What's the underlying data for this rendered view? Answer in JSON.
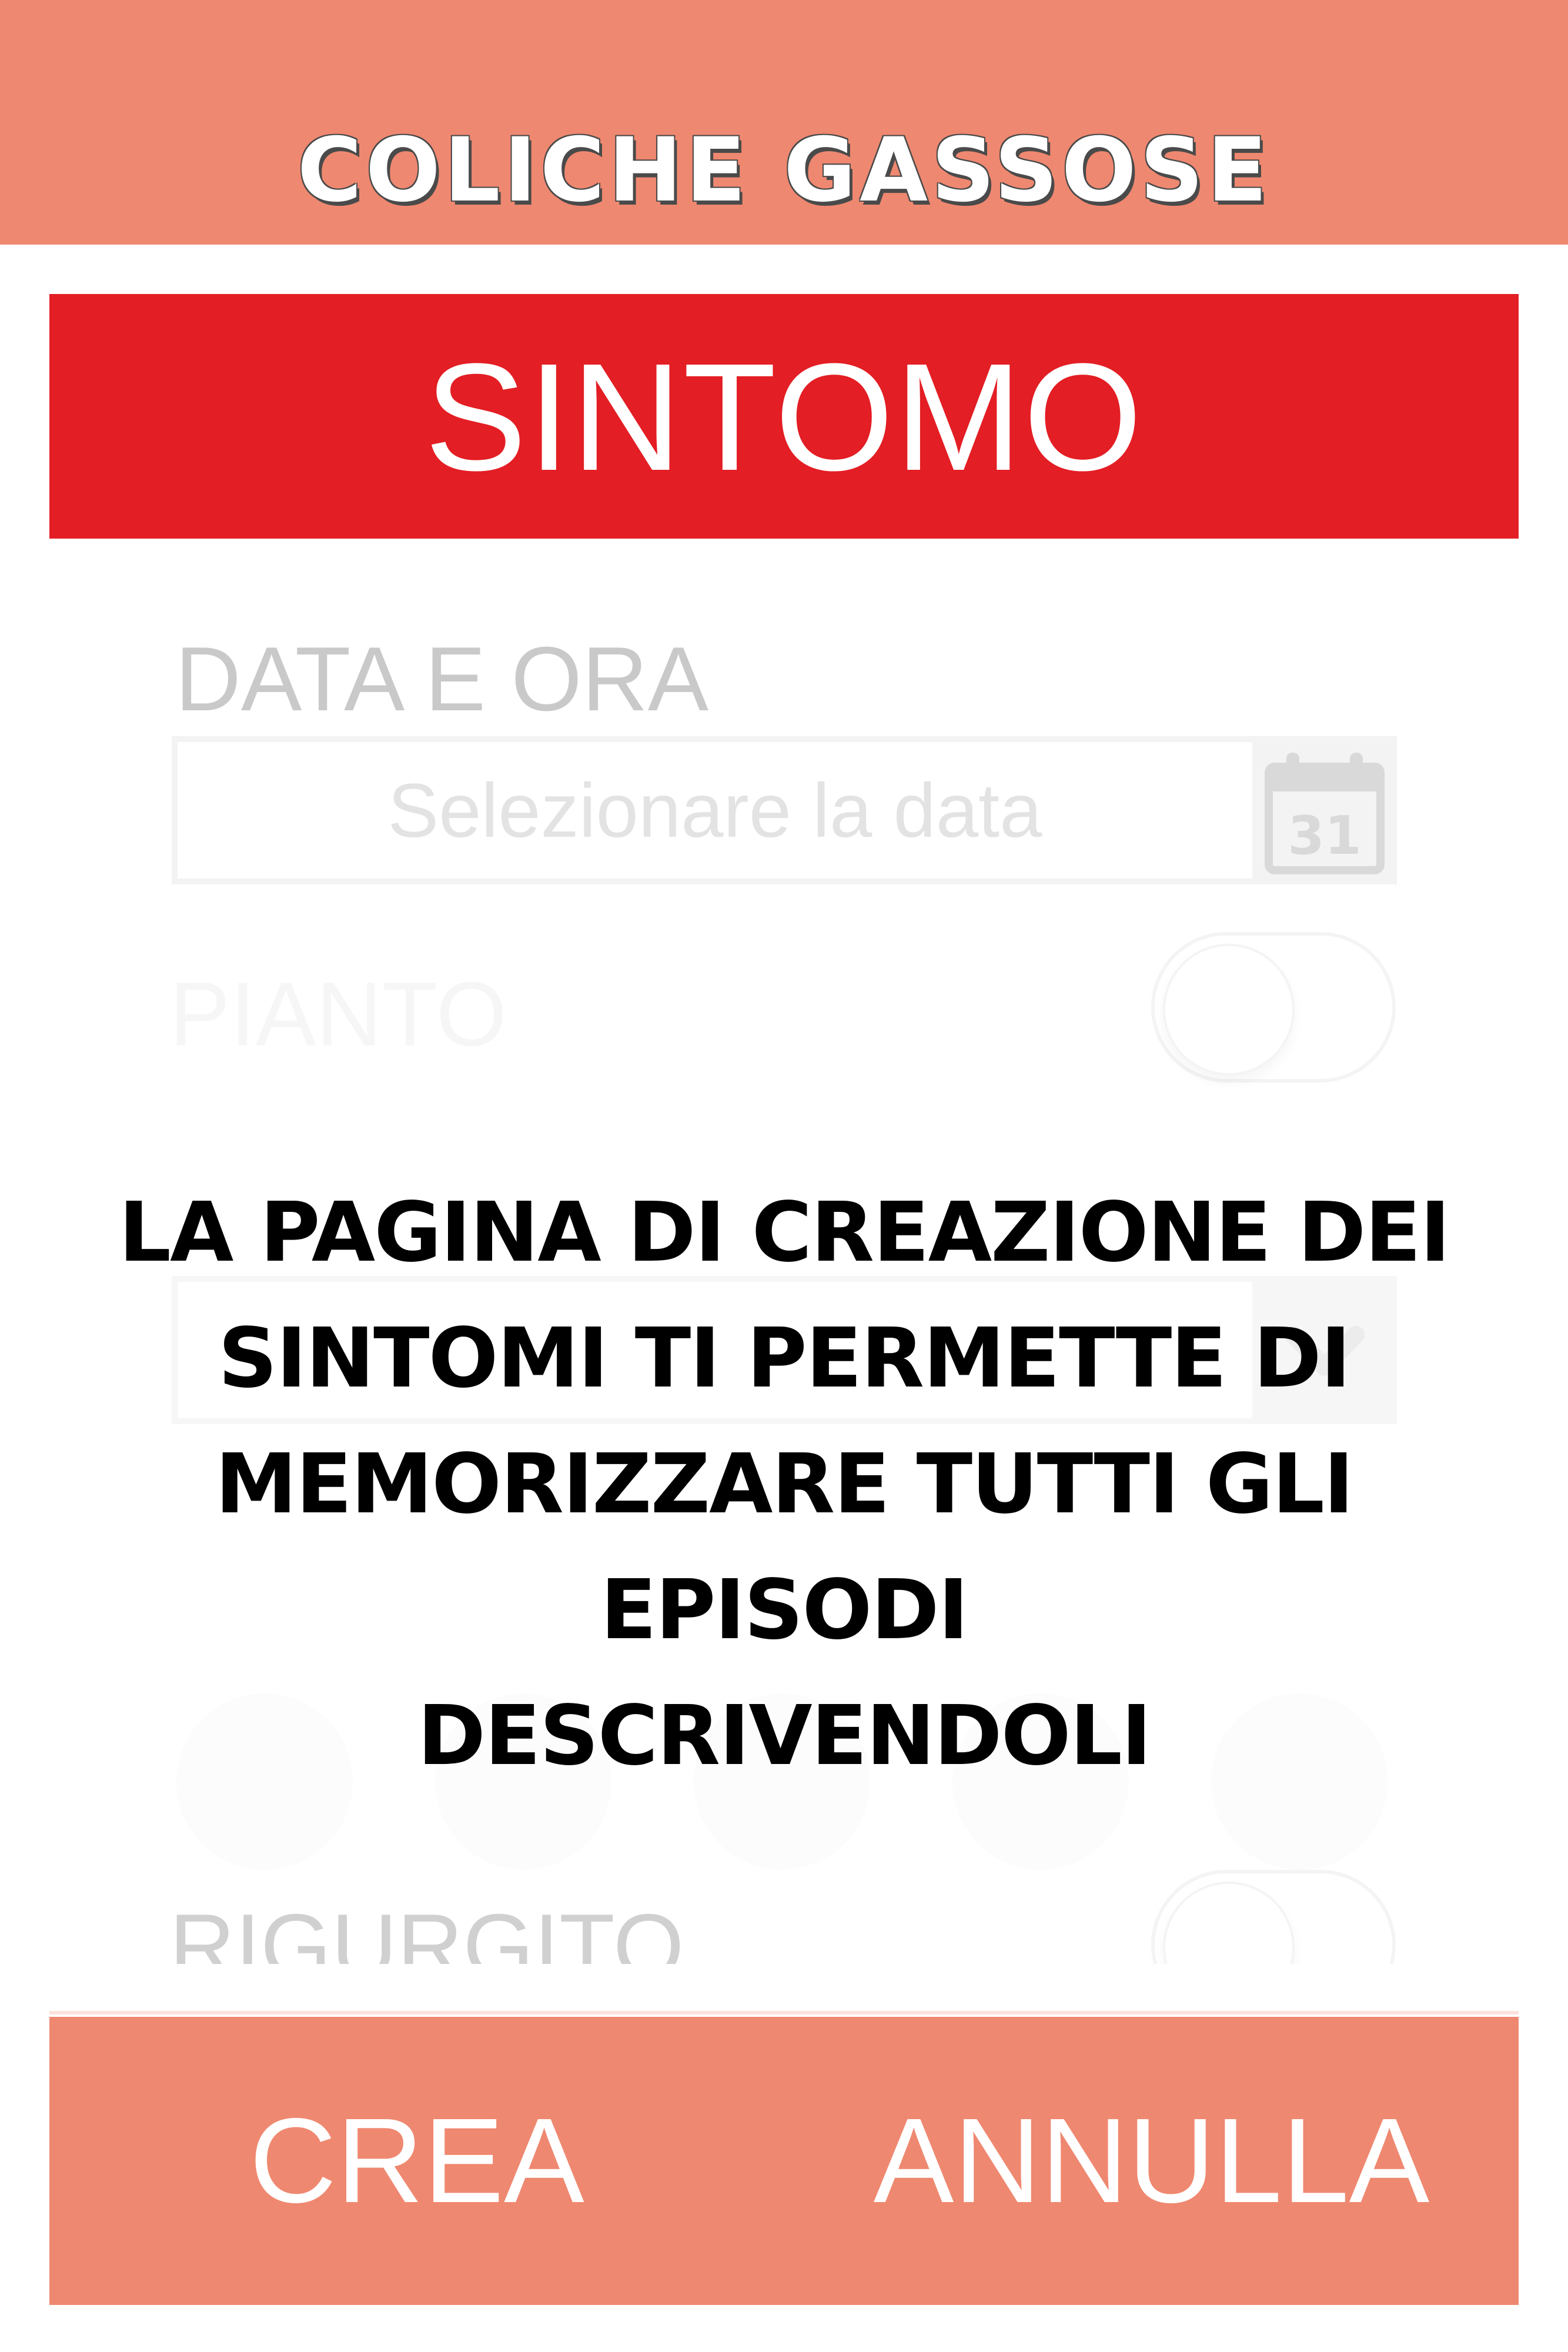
{
  "colors": {
    "header_bg": "#ef8870",
    "banner_bg": "#e31e24",
    "footer_bg": "#ef8870",
    "text_overlay": "#000000"
  },
  "header": {
    "title": "COLICHE GASSOSE"
  },
  "section": {
    "title": "SINTOMO"
  },
  "form": {
    "date_label": "DATA E ORA",
    "date_placeholder": "Selezionare la data",
    "calendar_icon": "calendar-icon",
    "calendar_day": "31",
    "crying_label": "PIANTO",
    "rigurgito_label": "RIGURGITO"
  },
  "overlay": {
    "lines": [
      "LA PAGINA DI CREAZIONE DEI",
      "SINTOMI TI PERMETTE DI",
      "MEMORIZZARE TUTTI GLI EPISODI",
      "DESCRIVENDOLI"
    ]
  },
  "footer": {
    "create_label": "CREA",
    "cancel_label": "ANNULLA"
  }
}
